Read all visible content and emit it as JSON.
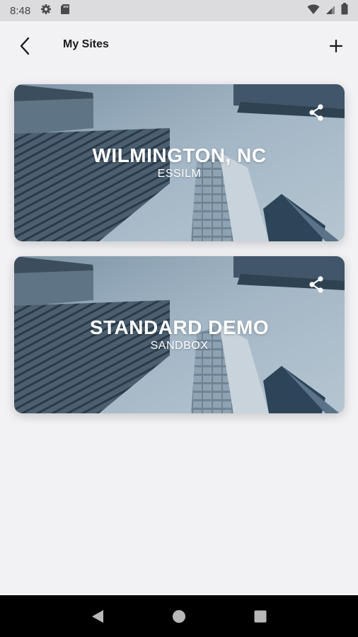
{
  "status_bar": {
    "time": "8:48",
    "icons": [
      "settings-icon",
      "sd-card-icon",
      "wifi-icon",
      "signal-icon",
      "battery-icon"
    ]
  },
  "header": {
    "title": "My Sites",
    "back_icon": "back-arrow-icon",
    "add_icon": "plus-icon"
  },
  "sites": [
    {
      "title": "WILMINGTON, NC",
      "subtitle": "ESSILM",
      "share_icon": "share-icon"
    },
    {
      "title": "STANDARD DEMO",
      "subtitle": "SANDBOX",
      "share_icon": "share-icon"
    }
  ],
  "nav_bar": {
    "icons": [
      "nav-back-icon",
      "nav-home-icon",
      "nav-recents-icon"
    ]
  },
  "colors": {
    "background": "#f2f2f5",
    "status_bar": "#dcdcdf",
    "card_sky": "#9fb3c3",
    "text_dark": "#1a1a1a"
  }
}
